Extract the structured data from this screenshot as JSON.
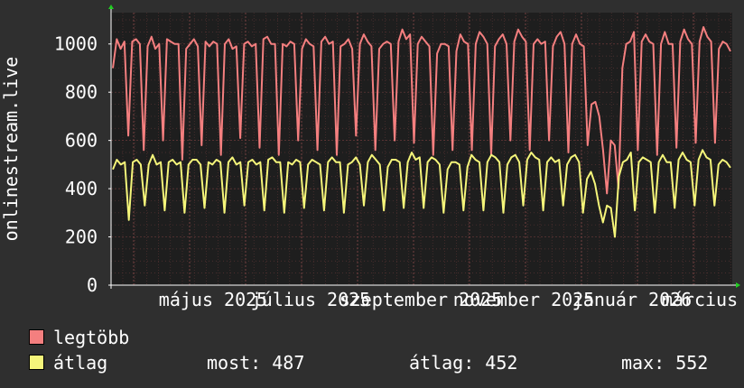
{
  "chart_data": {
    "type": "line",
    "ylabel": "onlinestream.live",
    "ylim": [
      0,
      1130
    ],
    "y_ticks": [
      "0",
      "200",
      "400",
      "600",
      "800",
      "1000"
    ],
    "x_tick_labels": [
      "május 2025",
      "július 2025",
      "szeptember 2025",
      "november 2025",
      "január 2026",
      "március"
    ],
    "grid": true,
    "colors": {
      "legtobb": "#f47f7f",
      "atlag": "#f5f57a",
      "background": "#1e1e1e",
      "grid": "#5a3434"
    },
    "series": [
      {
        "name": "legtöbb",
        "values": [
          900,
          1020,
          980,
          1010,
          620,
          1010,
          1020,
          1000,
          560,
          990,
          1030,
          980,
          1000,
          600,
          1020,
          1010,
          1000,
          1000,
          520,
          980,
          1000,
          1020,
          990,
          580,
          1010,
          990,
          1010,
          1000,
          540,
          1000,
          1020,
          980,
          990,
          610,
          1000,
          1010,
          990,
          1000,
          570,
          1020,
          1030,
          1000,
          1000,
          540,
          1000,
          990,
          1010,
          1000,
          600,
          980,
          1020,
          1000,
          990,
          560,
          1010,
          1030,
          1000,
          1010,
          540,
          990,
          1000,
          1020,
          980,
          620,
          1000,
          1040,
          1010,
          990,
          560,
          980,
          1000,
          1010,
          1000,
          600,
          1010,
          1060,
          1020,
          1040,
          590,
          1000,
          1030,
          1010,
          990,
          540,
          960,
          1000,
          1000,
          990,
          560,
          970,
          1040,
          1010,
          1000,
          560,
          1000,
          1050,
          1030,
          1000,
          540,
          990,
          1020,
          1040,
          1000,
          600,
          1010,
          1060,
          1030,
          1010,
          560,
          1000,
          1020,
          1000,
          1010,
          600,
          990,
          1030,
          1050,
          1000,
          550,
          1000,
          1040,
          1000,
          990,
          580,
          750,
          760,
          700,
          560,
          380,
          600,
          580,
          400,
          900,
          1000,
          1010,
          1050,
          560,
          1010,
          1040,
          1010,
          1000,
          540,
          1000,
          1050,
          1000,
          1000,
          570,
          1010,
          1060,
          1020,
          1000,
          590,
          1010,
          1070,
          1030,
          1010,
          590,
          980,
          1010,
          1000,
          970
        ]
      },
      {
        "name": "átlag",
        "values": [
          480,
          520,
          500,
          510,
          270,
          510,
          520,
          500,
          330,
          500,
          540,
          500,
          510,
          310,
          510,
          520,
          500,
          510,
          300,
          500,
          520,
          520,
          500,
          320,
          510,
          500,
          520,
          510,
          300,
          510,
          530,
          500,
          510,
          330,
          510,
          520,
          500,
          510,
          310,
          520,
          530,
          510,
          510,
          300,
          510,
          500,
          520,
          510,
          320,
          500,
          520,
          510,
          500,
          310,
          510,
          530,
          510,
          510,
          300,
          500,
          510,
          530,
          500,
          330,
          510,
          540,
          520,
          500,
          310,
          490,
          520,
          520,
          510,
          320,
          510,
          550,
          520,
          530,
          320,
          510,
          530,
          520,
          500,
          300,
          480,
          510,
          510,
          500,
          310,
          490,
          540,
          520,
          510,
          310,
          510,
          540,
          530,
          510,
          300,
          500,
          530,
          540,
          510,
          330,
          520,
          550,
          530,
          520,
          310,
          510,
          530,
          510,
          520,
          330,
          500,
          530,
          540,
          510,
          300,
          440,
          470,
          420,
          330,
          260,
          330,
          320,
          200,
          450,
          510,
          520,
          550,
          310,
          510,
          530,
          520,
          510,
          300,
          510,
          540,
          510,
          510,
          320,
          520,
          550,
          520,
          510,
          330,
          520,
          560,
          530,
          520,
          330,
          500,
          520,
          510,
          487
        ]
      }
    ]
  },
  "legend": {
    "legtobb_label": "legtöbb",
    "atlag_label": "átlag"
  },
  "stats": {
    "most_label": "most:",
    "most_value": "487",
    "atlag_label": "átlag:",
    "atlag_value": "452",
    "max_label": "max:",
    "max_value": "552"
  }
}
